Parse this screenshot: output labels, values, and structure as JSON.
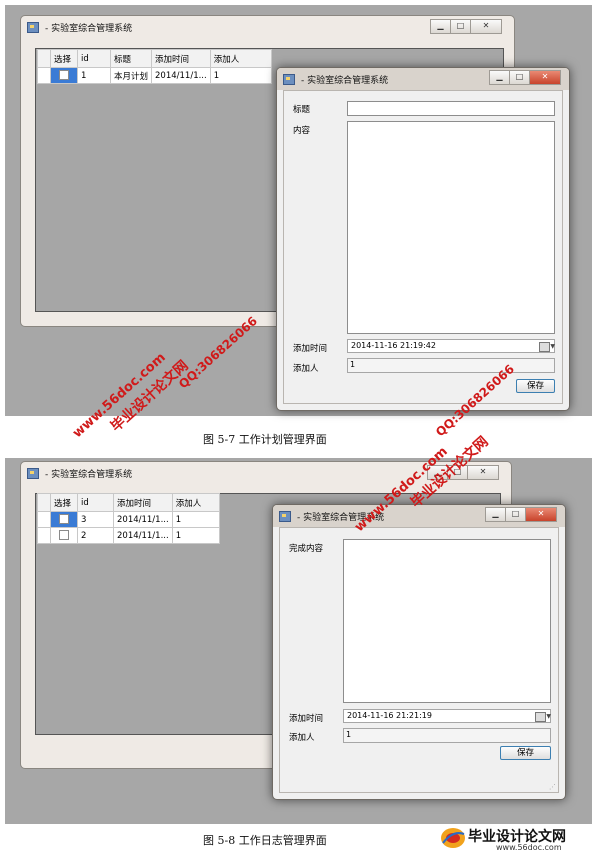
{
  "figure1": {
    "main_window": {
      "title": "- 实验室综合管理系统",
      "columns": [
        "选择",
        "id",
        "标题",
        "添加时间",
        "添加人"
      ],
      "rows": [
        {
          "id": "1",
          "title": "本月计划",
          "time": "2014/11/1...",
          "adder": "1"
        }
      ]
    },
    "dialog": {
      "title": "- 实验室综合管理系统",
      "title_label": "标题",
      "title_value": "",
      "content_label": "内容",
      "time_label": "添加时间",
      "time_value": "2014-11-16  21:19:42",
      "adder_label": "添加人",
      "adder_value": "1",
      "save_label": "保存"
    },
    "caption": "图 5-7 工作计划管理界面",
    "watermark_site": "www.56doc.com",
    "watermark_brand": "毕业设计论文网",
    "watermark_qq": "QQ:306826066"
  },
  "figure2": {
    "main_window": {
      "title": "- 实验室综合管理系统",
      "columns": [
        "选择",
        "id",
        "添加时间",
        "添加人"
      ],
      "rows": [
        {
          "id": "3",
          "time": "2014/11/1...",
          "adder": "1",
          "checked": true
        },
        {
          "id": "2",
          "time": "2014/11/1...",
          "adder": "1",
          "checked": false
        }
      ]
    },
    "dialog": {
      "title": "- 实验室综合管理系统",
      "content_label": "完成内容",
      "time_label": "添加时间",
      "time_value": "2014-11-16  21:21:19",
      "adder_label": "添加人",
      "adder_value": "1",
      "save_label": "保存"
    },
    "caption": "图 5-8 工作日志管理界面",
    "watermark_site": "www.56doc.com",
    "watermark_brand": "毕业设计论文网",
    "watermark_qq": "QQ:306826066"
  },
  "footer_logo": {
    "brand": "毕业设计论文网",
    "site": "www.56doc.com"
  },
  "colors": {
    "panel_bg": "#a7a7a7",
    "window_frame": "#efeae5",
    "selection_blue": "#3a7bd5",
    "close_red": "#c8432b",
    "watermark_red": "#d01a1a"
  }
}
